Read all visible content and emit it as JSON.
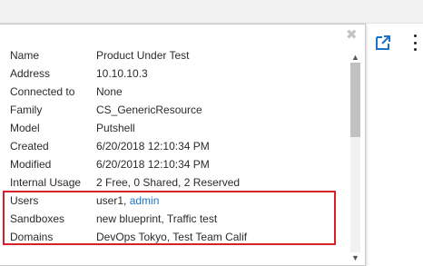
{
  "properties": [
    {
      "label": "Name",
      "value": "Product Under Test"
    },
    {
      "label": "Address",
      "value": "10.10.10.3"
    },
    {
      "label": "Connected to",
      "value": "None"
    },
    {
      "label": "Family",
      "value": "CS_GenericResource"
    },
    {
      "label": "Model",
      "value": "Putshell"
    },
    {
      "label": "Created",
      "value": "6/20/2018 12:10:34 PM"
    },
    {
      "label": "Modified",
      "value": "6/20/2018 12:10:34 PM"
    },
    {
      "label": "Internal Usage",
      "value": "2 Free, 0 Shared, 2 Reserved"
    }
  ],
  "users": {
    "label": "Users",
    "plain": "user1, ",
    "link": "admin"
  },
  "sandboxes": {
    "label": "Sandboxes",
    "value": "new blueprint, Traffic test"
  },
  "domains": {
    "label": "Domains",
    "value": "DevOps Tokyo, Test Team Calif"
  },
  "icons": {
    "close": "close-icon",
    "open_external": "open-external-icon",
    "more": "more-options-icon",
    "scroll_down": "scroll-down-icon"
  },
  "colors": {
    "accent": "#1a73c8",
    "highlight": "#d6202a"
  }
}
